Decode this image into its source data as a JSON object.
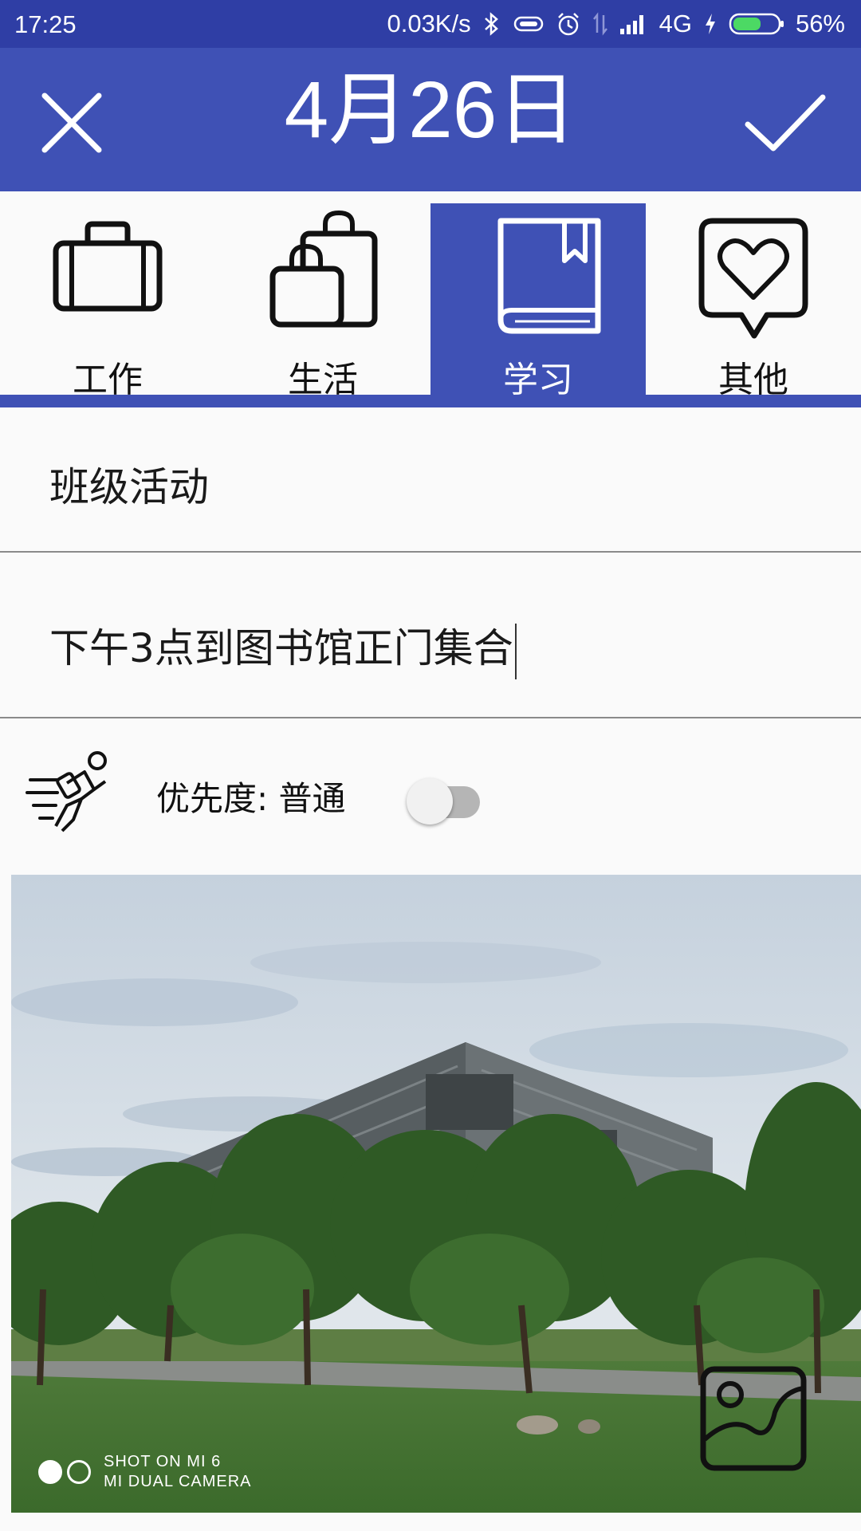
{
  "status_bar": {
    "time": "17:25",
    "network_speed": "0.03K/s",
    "network_type": "4G",
    "battery": "56%",
    "icons": [
      "bluetooth-icon",
      "vibrate-icon",
      "alarm-icon",
      "data-transfer-icon",
      "signal-icon",
      "charging-icon",
      "battery-icon"
    ]
  },
  "app_bar": {
    "title": "4月26日",
    "close_icon": "close-icon",
    "confirm_icon": "checkmark-icon",
    "background": "#3f51b5"
  },
  "categories": {
    "selected_index": 2,
    "items": [
      {
        "label": "工作",
        "icon": "briefcase-icon"
      },
      {
        "label": "生活",
        "icon": "shopping-bags-icon"
      },
      {
        "label": "学习",
        "icon": "book-icon"
      },
      {
        "label": "其他",
        "icon": "heart-bubble-icon"
      }
    ]
  },
  "form": {
    "title_value": "班级活动",
    "content_value": "下午3点到图书馆正门集合"
  },
  "priority": {
    "icon": "runner-icon",
    "label": "优先度: 普通",
    "toggle_on": false
  },
  "photo": {
    "watermark_line1": "SHOT ON MI 6",
    "watermark_line2": "MI DUAL CAMERA",
    "add_image_icon": "image-icon"
  }
}
